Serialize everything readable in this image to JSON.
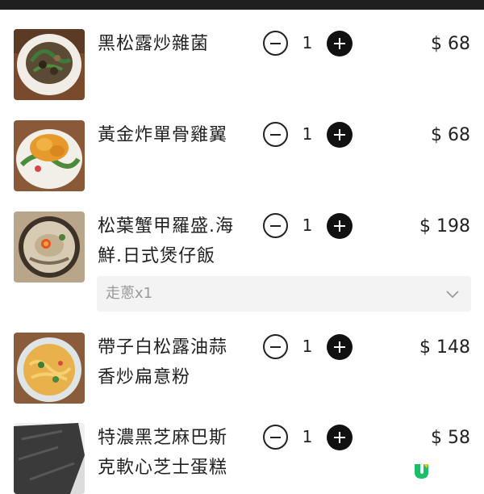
{
  "currency": "$",
  "items": [
    {
      "name_lines": [
        "黑松露炒雜菌"
      ],
      "qty": "1",
      "price": "$ 68"
    },
    {
      "name_lines": [
        "黃金炸單骨雞翼"
      ],
      "qty": "1",
      "price": "$ 68"
    },
    {
      "name_lines": [
        "松葉蟹甲羅盛.海",
        "鮮.日式煲仔飯"
      ],
      "qty": "1",
      "price": "$ 198",
      "option": "走蔥x1"
    },
    {
      "name_lines": [
        "帶子白松露油蒜",
        "香炒扁意粉"
      ],
      "qty": "1",
      "price": "$ 148"
    },
    {
      "name_lines": [
        "特濃黑芝麻巴斯",
        "克軟心芝士蛋糕"
      ],
      "qty": "1",
      "price": "$ 58"
    }
  ],
  "icons": {
    "decrement": "minus-circle-icon",
    "increment": "plus-circle-icon",
    "option_toggle": "chevron-down-icon",
    "brand": "u-logo-icon"
  },
  "colors": {
    "topbar": "#1f1f1f",
    "text": "#222222",
    "option_bg": "#f3f3f3",
    "option_text": "#9a9a9a",
    "brand_green": "#1bbf6a"
  }
}
